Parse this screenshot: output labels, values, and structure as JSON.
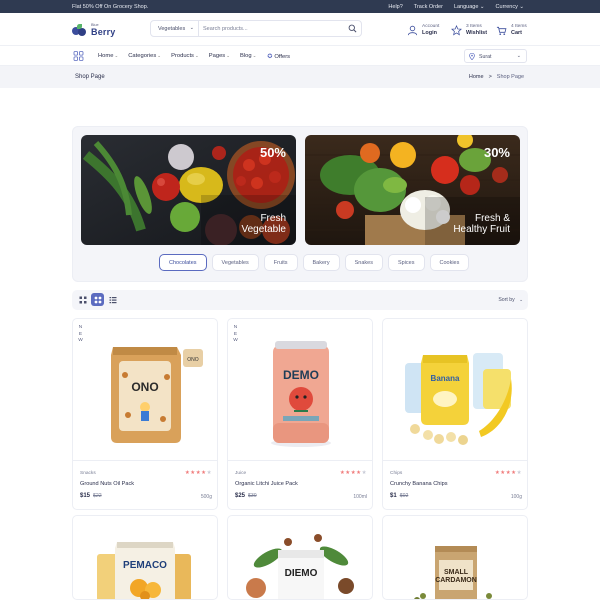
{
  "topbar": {
    "promo": "Flat 50% Off On Grocery Shop.",
    "links": [
      "Help?",
      "Track Order",
      "Language ⌄",
      "Currency ⌄"
    ]
  },
  "header": {
    "logo_small": "Blue",
    "logo_big": "Berry",
    "search_category": "Vegetables",
    "search_placeholder": "Search products...",
    "account_top": "Account",
    "account_bottom": "Login",
    "wishlist_top": "3 Items",
    "wishlist_bottom": "Wishlist",
    "cart_top": "4 Items",
    "cart_bottom": "Cart"
  },
  "nav": {
    "items": [
      "Home",
      "Categories",
      "Products",
      "Pages",
      "Blog",
      "Offers"
    ],
    "location": "Surat"
  },
  "breadcrumb": {
    "title": "Shop Page",
    "home": "Home",
    "separator": ">",
    "current": "Shop Page"
  },
  "banners": [
    {
      "percent": "50%",
      "line1": "Fresh",
      "line2": "Vegetable"
    },
    {
      "percent": "30%",
      "line1": "Fresh &",
      "line2": "Healthy Fruit"
    }
  ],
  "filters": [
    "Chocolates",
    "Vegetables",
    "Fruits",
    "Bakery",
    "Snakes",
    "Spices",
    "Cookies"
  ],
  "filter_active": "Chocolates",
  "toolbar": {
    "sort_label": "Sort by"
  },
  "products": [
    {
      "tag": "NEW",
      "category": "Snacks",
      "name": "Ground Nuts Oil Pack",
      "price": "$15",
      "old_price": "$22",
      "weight": "500g",
      "rating": 4,
      "pack_text": "ONO"
    },
    {
      "tag": "NEW",
      "category": "Juice",
      "name": "Organic Litchi Juice Pack",
      "price": "$25",
      "old_price": "$30",
      "weight": "100ml",
      "rating": 4,
      "pack_text": "DEMO"
    },
    {
      "tag": "",
      "category": "Chips",
      "name": "Crunchy Banana Chips",
      "price": "$1",
      "old_price": "$02",
      "weight": "100g",
      "rating": 4,
      "pack_text": "Banana"
    },
    {
      "tag": "",
      "category": "",
      "name": "",
      "price": "",
      "old_price": "",
      "weight": "",
      "rating": 0,
      "pack_text": "PEMACO"
    },
    {
      "tag": "",
      "category": "",
      "name": "",
      "price": "",
      "old_price": "",
      "weight": "",
      "rating": 0,
      "pack_text": "DIEMO"
    },
    {
      "tag": "",
      "category": "",
      "name": "",
      "price": "",
      "old_price": "",
      "weight": "",
      "rating": 0,
      "pack_text": "SMALL CARDAMON"
    }
  ],
  "colors": {
    "topbar": "#2f3a51",
    "accent": "#5b6bc0",
    "star": "#f07c7c",
    "brand": "#2f3f85"
  }
}
